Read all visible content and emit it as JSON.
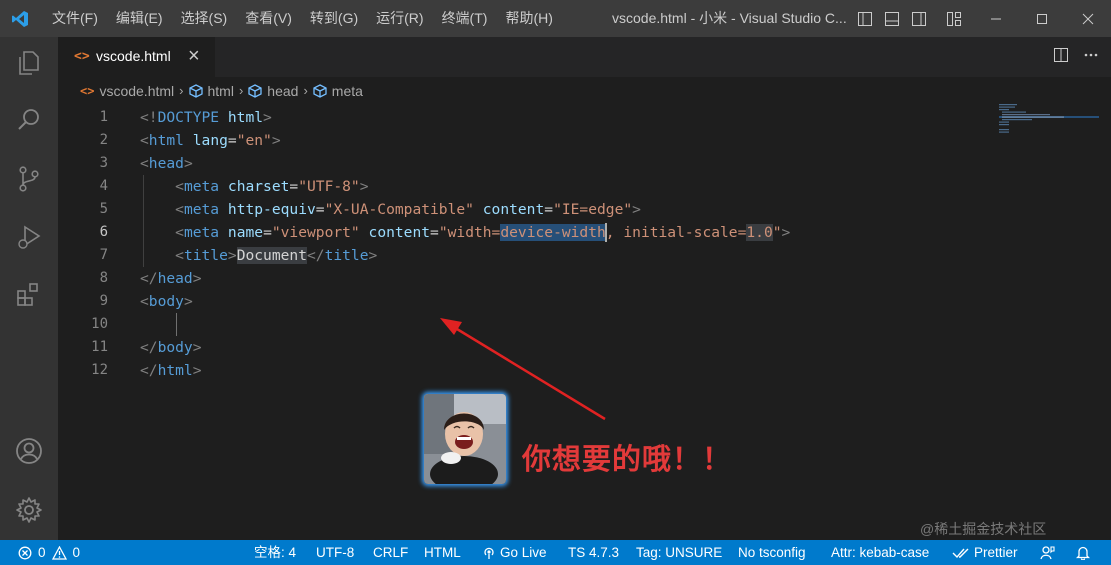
{
  "titlebar": {
    "menu": [
      "文件(F)",
      "编辑(E)",
      "选择(S)",
      "查看(V)",
      "转到(G)",
      "运行(R)",
      "终端(T)",
      "帮助(H)"
    ],
    "window_title": "vscode.html - 小米 - Visual Studio C..."
  },
  "activitybar": {
    "icons": [
      "explorer-icon",
      "search-icon",
      "source-control-icon",
      "run-debug-icon",
      "extensions-icon",
      "account-icon",
      "settings-gear-icon"
    ]
  },
  "tab": {
    "icon": "<>",
    "label": "vscode.html",
    "close": "×"
  },
  "breadcrumb": {
    "file": "vscode.html",
    "items": [
      "html",
      "head",
      "meta"
    ]
  },
  "editor": {
    "line_numbers": [
      "1",
      "2",
      "3",
      "4",
      "5",
      "6",
      "7",
      "8",
      "9",
      "10",
      "11",
      "12"
    ],
    "active_line": 6,
    "lines": [
      [
        [
          "t-punc",
          "<!"
        ],
        [
          "t-tag",
          "DOCTYPE"
        ],
        [
          "t-text",
          " "
        ],
        [
          "t-attr",
          "html"
        ],
        [
          "t-punc",
          ">"
        ]
      ],
      [
        [
          "t-punc",
          "<"
        ],
        [
          "t-tag",
          "html"
        ],
        [
          "t-text",
          " "
        ],
        [
          "t-attr",
          "lang"
        ],
        [
          "t-text",
          "="
        ],
        [
          "t-str",
          "\"en\""
        ],
        [
          "t-punc",
          ">"
        ]
      ],
      [
        [
          "t-punc",
          "<"
        ],
        [
          "t-tag",
          "head"
        ],
        [
          "t-punc",
          ">"
        ]
      ],
      [
        [
          "t-text",
          "    "
        ],
        [
          "t-punc",
          "<"
        ],
        [
          "t-tag",
          "meta"
        ],
        [
          "t-text",
          " "
        ],
        [
          "t-attr",
          "charset"
        ],
        [
          "t-text",
          "="
        ],
        [
          "t-str",
          "\"UTF-8\""
        ],
        [
          "t-punc",
          ">"
        ]
      ],
      [
        [
          "t-text",
          "    "
        ],
        [
          "t-punc",
          "<"
        ],
        [
          "t-tag",
          "meta"
        ],
        [
          "t-text",
          " "
        ],
        [
          "t-attr",
          "http-equiv"
        ],
        [
          "t-text",
          "="
        ],
        [
          "t-str",
          "\"X-UA-Compatible\""
        ],
        [
          "t-text",
          " "
        ],
        [
          "t-attr",
          "content"
        ],
        [
          "t-text",
          "="
        ],
        [
          "t-str",
          "\"IE=edge\""
        ],
        [
          "t-punc",
          ">"
        ]
      ],
      [
        [
          "t-text",
          "    "
        ],
        [
          "t-punc",
          "<"
        ],
        [
          "t-tag",
          "meta"
        ],
        [
          "t-text",
          " "
        ],
        [
          "t-attr",
          "name"
        ],
        [
          "t-text",
          "="
        ],
        [
          "t-str",
          "\"viewport\""
        ],
        [
          "t-text",
          " "
        ],
        [
          "t-attr",
          "content"
        ],
        [
          "t-text",
          "="
        ],
        [
          "t-str",
          "\"width="
        ],
        [
          "t-str sel",
          "device-width"
        ],
        [
          "t-str",
          ", initial-scale="
        ],
        [
          "t-str sel2",
          "1.0"
        ],
        [
          "t-str",
          "\""
        ],
        [
          "t-punc",
          ">"
        ]
      ],
      [
        [
          "t-text",
          "    "
        ],
        [
          "t-punc",
          "<"
        ],
        [
          "t-tag",
          "title"
        ],
        [
          "t-punc",
          ">"
        ],
        [
          "t-text sel2",
          "Document"
        ],
        [
          "t-punc",
          "</"
        ],
        [
          "t-tag",
          "title"
        ],
        [
          "t-punc",
          ">"
        ]
      ],
      [
        [
          "t-punc",
          "</"
        ],
        [
          "t-tag",
          "head"
        ],
        [
          "t-punc",
          ">"
        ]
      ],
      [
        [
          "t-punc",
          "<"
        ],
        [
          "t-tag",
          "body"
        ],
        [
          "t-punc",
          ">"
        ]
      ],
      [
        [
          "t-text",
          ""
        ]
      ],
      [
        [
          "t-punc",
          "</"
        ],
        [
          "t-tag",
          "body"
        ],
        [
          "t-punc",
          ">"
        ]
      ],
      [
        [
          "t-punc",
          "</"
        ],
        [
          "t-tag",
          "html"
        ],
        [
          "t-punc",
          ">"
        ]
      ]
    ]
  },
  "annotation": {
    "caption": "你想要的哦！！",
    "sticker": "laughing-child-photo"
  },
  "statusbar": {
    "errors": "0",
    "warnings": "0",
    "items": [
      "空格: 4",
      "UTF-8",
      "CRLF",
      "HTML",
      "Go Live",
      "TS 4.7.3",
      "Tag: UNSURE",
      "No tsconfig",
      "Attr: kebab-case",
      "Prettier"
    ]
  },
  "watermark": "@稀土掘金技术社区",
  "colors": {
    "accent": "#007acc",
    "caption": "#e23a3a",
    "arrow": "#e02222"
  }
}
